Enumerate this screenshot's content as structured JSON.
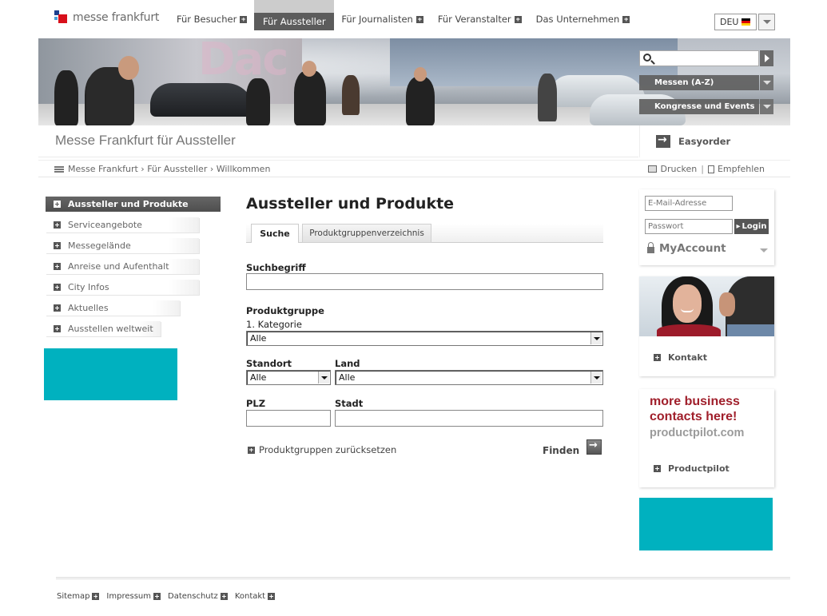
{
  "brand": {
    "logo_text": "messe frankfurt"
  },
  "topnav": [
    {
      "label": "Für Besucher",
      "active": false
    },
    {
      "label": "Für Aussteller",
      "active": true
    },
    {
      "label": "Für Journalisten",
      "active": false
    },
    {
      "label": "Für Veranstalter",
      "active": false
    },
    {
      "label": "Das Unternehmen",
      "active": false
    }
  ],
  "language": {
    "value": "DEU"
  },
  "banner": {
    "search_value": "",
    "select_fairs": "Messen (A-Z)",
    "select_congress": "Kongresse und Events"
  },
  "page_title": "Messe Frankfurt für Aussteller",
  "easyorder_label": "Easyorder",
  "breadcrumb": "Messe Frankfurt › Für Aussteller › Willkommen",
  "tools": {
    "print": "Drucken",
    "recommend": "Empfehlen"
  },
  "leftnav": [
    {
      "label": "Aussteller und Produkte",
      "active": true
    },
    {
      "label": "Serviceangebote"
    },
    {
      "label": "Messegelände"
    },
    {
      "label": "Anreise und Aufenthalt"
    },
    {
      "label": "City Infos"
    },
    {
      "label": "Aktuelles"
    },
    {
      "label": "Ausstellen weltweit"
    }
  ],
  "colors": {
    "teal": "#00b1bf",
    "nav_active": "#5c5c5c",
    "pilot_red": "#a01f2b"
  },
  "main": {
    "heading": "Aussteller und Produkte",
    "tabs": [
      "Suche",
      "Produktgruppenverzeichnis"
    ],
    "search_label": "Suchbegriff",
    "search_value": "",
    "group_heading": "Produktgruppe",
    "category_label": "1. Kategorie",
    "category_value": "Alle",
    "location_label": "Standort",
    "location_value": "Alle",
    "country_label": "Land",
    "country_value": "Alle",
    "zip_label": "PLZ",
    "zip_value": "",
    "city_label": "Stadt",
    "city_value": "",
    "reset_label": "Produktgruppen zurücksetzen",
    "find_label": "Finden"
  },
  "login": {
    "email_placeholder": "E-Mail-Adresse",
    "password_placeholder": "Passwort",
    "login_button": "Login",
    "myaccount": "MyAccount"
  },
  "contact_label": "Kontakt",
  "pilot": {
    "line1": "more business",
    "line2": "contacts here!",
    "line3": "productpilot.com",
    "link": "Productpilot"
  },
  "footer": [
    "Sitemap",
    "Impressum",
    "Datenschutz",
    "Kontakt"
  ]
}
